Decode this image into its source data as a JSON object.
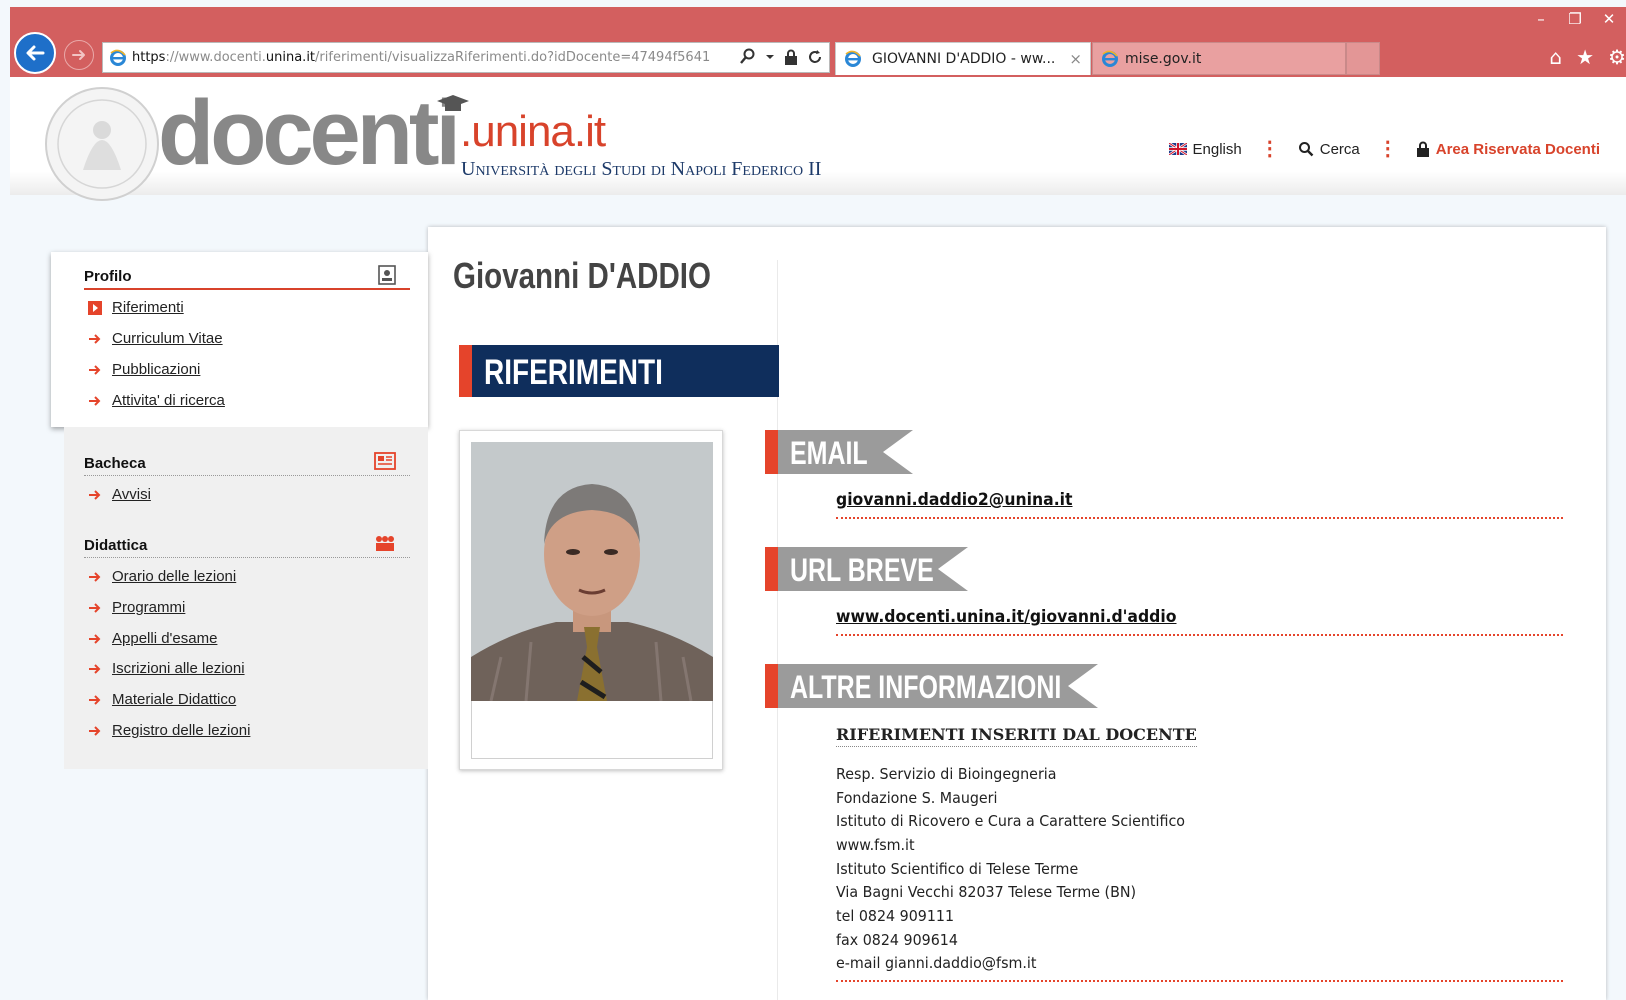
{
  "browser": {
    "url_prefix": "https",
    "url_domain_pre": "://www.docenti.",
    "url_domain_em": "unina.it",
    "url_path": "/riferimenti/visualizzaRiferimenti.do?idDocente=47494f5641",
    "tabs": [
      {
        "title": "GIOVANNI D'ADDIO - ww...",
        "active": true,
        "close": "×"
      },
      {
        "title": "mise.gov.it",
        "active": false
      }
    ],
    "window_controls": [
      "–",
      "❐",
      "✕"
    ],
    "tool_icons": [
      "home-icon",
      "star-icon",
      "gear-icon"
    ]
  },
  "site": {
    "logo_docenti": "docenti",
    "logo_unina": ".unina.it",
    "logo_university": "Università degli Studi di Napoli Federico II",
    "nav": {
      "english": "English",
      "search": "Cerca",
      "reserved": "Area Riservata Docenti"
    }
  },
  "sidebar": {
    "profilo": {
      "title": "Profilo",
      "items": [
        {
          "label": "Riferimenti",
          "active": true
        },
        {
          "label": "Curriculum Vitae"
        },
        {
          "label": "Pubblicazioni"
        },
        {
          "label": "Attivita' di ricerca"
        }
      ]
    },
    "bacheca": {
      "title": "Bacheca",
      "items": [
        {
          "label": "Avvisi"
        }
      ]
    },
    "didattica": {
      "title": "Didattica",
      "items": [
        {
          "label": "Orario delle lezioni"
        },
        {
          "label": "Programmi"
        },
        {
          "label": "Appelli d'esame"
        },
        {
          "label": "Iscrizioni alle lezioni"
        },
        {
          "label": "Materiale Didattico"
        },
        {
          "label": "Registro delle lezioni"
        }
      ]
    }
  },
  "main": {
    "name": "Giovanni  D'ADDIO",
    "section_title": "RIFERIMENTI",
    "email_label": "EMAIL",
    "email": "giovanni.daddio2@unina.it",
    "url_label": "URL BREVE",
    "short_url": "www.docenti.unina.it/giovanni.d'addio",
    "info_label": "ALTRE INFORMAZIONI",
    "info_heading": "RIFERIMENTI INSERITI DAL DOCENTE",
    "info_lines": [
      "Resp. Servizio di Bioingegneria",
      "Fondazione S. Maugeri",
      "Istituto di Ricovero e Cura a Carattere Scientifico",
      "www.fsm.it",
      "Istituto Scientifico di Telese Terme",
      "Via Bagni Vecchi 82037 Telese Terme (BN)",
      "tel 0824 909111",
      "fax 0824 909614",
      "e-mail gianni.daddio@fsm.it"
    ]
  },
  "colors": {
    "chrome": "#d35f5f",
    "accent": "#e5442b",
    "navy": "#0f2e5c",
    "ribbon_gray": "#9b9b9b"
  }
}
